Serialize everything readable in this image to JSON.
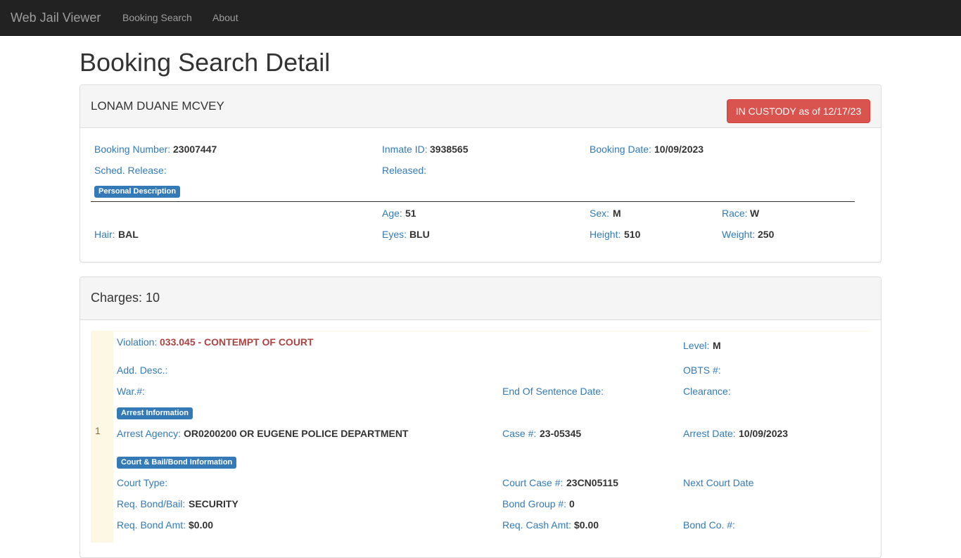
{
  "navbar": {
    "brand": "Web Jail Viewer",
    "links": [
      "Booking Search",
      "About"
    ]
  },
  "page": {
    "title": "Booking Search Detail"
  },
  "inmate": {
    "name": "LONAM DUANE MCVEY",
    "status": "IN CUSTODY as of 12/17/23",
    "status_color": "#d9534f",
    "booking_number_label": "Booking Number:",
    "booking_number": "23007447",
    "inmate_id_label": "Inmate ID:",
    "inmate_id": "3938565",
    "booking_date_label": "Booking Date:",
    "booking_date": "10/09/2023",
    "sched_release_label": "Sched. Release:",
    "released_label": "Released:",
    "personal_badge": "Personal Description",
    "age_label": "Age:",
    "age": "51",
    "sex_label": "Sex:",
    "sex": "M",
    "race_label": "Race:",
    "race": "W",
    "hair_label": "Hair:",
    "hair": "BAL",
    "eyes_label": "Eyes:",
    "eyes": "BLU",
    "height_label": "Height:",
    "height": "510",
    "weight_label": "Weight:",
    "weight": "250"
  },
  "charges": {
    "heading": "Charges: 10",
    "items": [
      {
        "number": "1",
        "violation_label": "Violation:",
        "violation": "033.045 - CONTEMPT OF COURT",
        "level_label": "Level:",
        "level": "M",
        "add_desc_label": "Add. Desc.:",
        "obts_label": "OBTS #:",
        "war_label": "War.#:",
        "end_sentence_label": "End Of Sentence Date:",
        "clearance_label": "Clearance:",
        "arrest_badge": "Arrest Information",
        "arrest_agency_label": "Arrest Agency:",
        "arrest_agency": "OR0200200 OR EUGENE POLICE DEPARTMENT",
        "case_label": "Case #:",
        "case": "23-05345",
        "arrest_date_label": "Arrest Date:",
        "arrest_date": "10/09/2023",
        "court_badge": "Court & Bail/Bond Information",
        "court_type_label": "Court Type:",
        "court_case_label": "Court Case #:",
        "court_case": "23CN05115",
        "next_court_label": "Next Court Date",
        "req_bond_bail_label": "Req. Bond/Bail:",
        "req_bond_bail": "SECURITY",
        "bond_group_label": "Bond Group #:",
        "bond_group": "0",
        "req_bond_amt_label": "Req. Bond Amt:",
        "req_bond_amt": "$0.00",
        "req_cash_amt_label": "Req. Cash Amt:",
        "req_cash_amt": "$0.00",
        "bond_co_label": "Bond Co. #:"
      }
    ]
  }
}
